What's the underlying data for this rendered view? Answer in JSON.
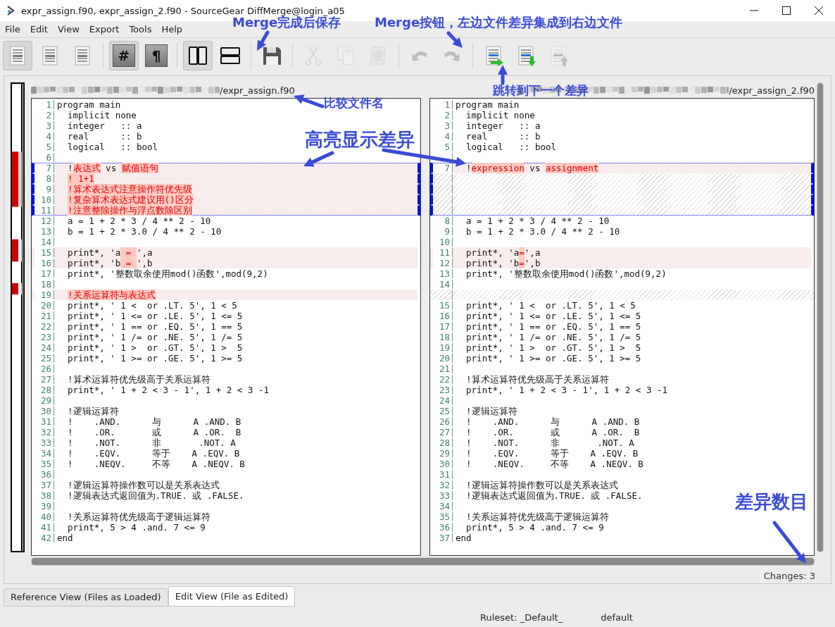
{
  "window": {
    "title": "expr_assign.f90, expr_assign_2.f90 - SourceGear DiffMerge@login_a05"
  },
  "menu": [
    "File",
    "Edit",
    "View",
    "Export",
    "Tools",
    "Help"
  ],
  "toolbar": [
    [
      {
        "pressed": true,
        "disabled": false
      },
      {
        "pressed": false,
        "disabled": false
      },
      {
        "pressed": false,
        "disabled": false
      }
    ],
    [
      {
        "pressed": true,
        "disabled": false,
        "glyph": "#"
      },
      {
        "pressed": false,
        "disabled": false,
        "glyph": "¶"
      }
    ],
    [
      {
        "pressed": true,
        "disabled": false
      },
      {
        "pressed": false,
        "disabled": false
      }
    ],
    [
      {
        "pressed": false,
        "disabled": false
      }
    ],
    [
      {
        "pressed": false,
        "disabled": true
      },
      {
        "pressed": false,
        "disabled": true
      },
      {
        "pressed": false,
        "disabled": true
      }
    ],
    [
      {
        "pressed": false,
        "disabled": true
      },
      {
        "pressed": false,
        "disabled": true
      }
    ],
    [
      {
        "pressed": false,
        "disabled": false
      },
      {
        "pressed": false,
        "disabled": false
      },
      {
        "pressed": false,
        "disabled": true
      }
    ]
  ],
  "left": {
    "file": "/expr_assign.f90",
    "rows": [
      {
        "num": "1",
        "kind": "same",
        "current": false,
        "text": "program main"
      },
      {
        "num": "2",
        "kind": "same",
        "current": false,
        "text": "  implicit none"
      },
      {
        "num": "3",
        "kind": "same",
        "current": false,
        "text": "  integer   :: a"
      },
      {
        "num": "4",
        "kind": "same",
        "current": false,
        "text": "  real      :: b"
      },
      {
        "num": "5",
        "kind": "same",
        "current": false,
        "text": "  logical   :: bool"
      },
      {
        "num": "6",
        "kind": "same",
        "current": false
      },
      {
        "num": "7",
        "kind": "changed",
        "current": true,
        "parts": [
          {
            "text": "  !",
            "diff": false
          },
          {
            "text": "表达式",
            "diff": true
          },
          {
            "text": " vs ",
            "diff": false
          },
          {
            "text": "赋值语句",
            "diff": true
          }
        ]
      },
      {
        "num": "8",
        "kind": "changed",
        "current": true,
        "indented": true,
        "parts": [
          {
            "text": "! 1+1",
            "diff": true
          }
        ]
      },
      {
        "num": "9",
        "kind": "changed",
        "current": true,
        "indented": true,
        "parts": [
          {
            "text": "!算术表达式注意操作符优先级",
            "diff": true
          }
        ]
      },
      {
        "num": "10",
        "kind": "changed",
        "current": true,
        "indented": true,
        "parts": [
          {
            "text": "!复杂算术表达式建议用()区分",
            "diff": true
          }
        ]
      },
      {
        "num": "11",
        "kind": "changed",
        "current": true,
        "indented": true,
        "parts": [
          {
            "text": "!注意整除操作与浮点数除区别",
            "diff": true
          }
        ]
      },
      {
        "num": "12",
        "kind": "same",
        "current": false,
        "text": "  a = 1 + 2 * 3 / 4 ** 2 - 10"
      },
      {
        "num": "13",
        "kind": "same",
        "current": false,
        "text": "  b = 1 + 2 * 3.0 / 4 ** 2 - 10"
      },
      {
        "num": "14",
        "kind": "same",
        "current": false
      },
      {
        "num": "15",
        "kind": "changed",
        "current": false,
        "parts": [
          {
            "text": "  print*, 'a",
            "diff": false
          },
          {
            "text": " = ",
            "diff": true
          },
          {
            "text": "',a",
            "diff": false
          }
        ]
      },
      {
        "num": "16",
        "kind": "changed",
        "current": false,
        "parts": [
          {
            "text": "  print*, 'b",
            "diff": false
          },
          {
            "text": " = ",
            "diff": true
          },
          {
            "text": "',b",
            "diff": false
          }
        ]
      },
      {
        "num": "17",
        "kind": "same",
        "current": false,
        "text": "  print*, '整数取余使用mod()函数',mod(9,2)"
      },
      {
        "num": "18",
        "kind": "same",
        "current": false
      },
      {
        "num": "19",
        "kind": "changed",
        "current": false,
        "indented": true,
        "parts": [
          {
            "text": "!关系运算符与表达式",
            "diff": true
          }
        ]
      },
      {
        "num": "20",
        "kind": "same",
        "current": false,
        "text": "  print*, ' 1 <  or .LT. 5', 1 < 5"
      },
      {
        "num": "21",
        "kind": "same",
        "current": false,
        "text": "  print*, ' 1 <= or .LE. 5', 1 <= 5"
      },
      {
        "num": "22",
        "kind": "same",
        "current": false,
        "text": "  print*, ' 1 == or .EQ. 5', 1 == 5"
      },
      {
        "num": "23",
        "kind": "same",
        "current": false,
        "text": "  print*, ' 1 /= or .NE. 5', 1 /= 5"
      },
      {
        "num": "24",
        "kind": "same",
        "current": false,
        "text": "  print*, ' 1 >  or .GT. 5', 1 >  5"
      },
      {
        "num": "25",
        "kind": "same",
        "current": false,
        "text": "  print*, ' 1 >= or .GE. 5', 1 >= 5"
      },
      {
        "num": "26",
        "kind": "same",
        "current": false
      },
      {
        "num": "27",
        "kind": "same",
        "current": false,
        "text": "  !算术运算符优先级高于关系运算符"
      },
      {
        "num": "28",
        "kind": "same",
        "current": false,
        "text": "  print*, ' 1 + 2 < 3 - 1', 1 + 2 < 3 -1"
      },
      {
        "num": "29",
        "kind": "same",
        "current": false
      },
      {
        "num": "30",
        "kind": "same",
        "current": false,
        "text": "  !逻辑运算符"
      },
      {
        "num": "31",
        "kind": "same",
        "current": false,
        "text": "  !    .AND.      与      A .AND. B"
      },
      {
        "num": "32",
        "kind": "same",
        "current": false,
        "text": "  !    .OR.       或      A .OR.  B"
      },
      {
        "num": "33",
        "kind": "same",
        "current": false,
        "text": "  !    .NOT.      非       .NOT. A"
      },
      {
        "num": "34",
        "kind": "same",
        "current": false,
        "text": "  !    .EQV.      等于    A .EQV. B"
      },
      {
        "num": "35",
        "kind": "same",
        "current": false,
        "text": "  !    .NEQV.     不等    A .NEQV. B"
      },
      {
        "num": "36",
        "kind": "same",
        "current": false
      },
      {
        "num": "37",
        "kind": "same",
        "current": false,
        "text": "  !逻辑运算符操作数可以是关系表达式"
      },
      {
        "num": "38",
        "kind": "same",
        "current": false,
        "text": "  !逻辑表达式返回值为.TRUE. 或 .FALSE."
      },
      {
        "num": "39",
        "kind": "same",
        "current": false
      },
      {
        "num": "40",
        "kind": "same",
        "current": false,
        "text": "  !关系运算符优先级高于逻辑运算符"
      },
      {
        "num": "41",
        "kind": "same",
        "current": false,
        "text": "  print*, 5 > 4 .and. 7 <= 9"
      },
      {
        "num": "42",
        "kind": "same",
        "current": false,
        "text": "end"
      }
    ]
  },
  "right": {
    "file": "/expr_assign_2.f90",
    "rows": [
      {
        "num": "1",
        "kind": "same",
        "current": false,
        "text": "program main"
      },
      {
        "num": "2",
        "kind": "same",
        "current": false,
        "text": "  implicit none"
      },
      {
        "num": "3",
        "kind": "same",
        "current": false,
        "text": "  integer   :: a"
      },
      {
        "num": "4",
        "kind": "same",
        "current": false,
        "text": "  real      :: b"
      },
      {
        "num": "5",
        "kind": "same",
        "current": false,
        "text": "  logical   :: bool"
      },
      {
        "kind": "same",
        "current": false
      },
      {
        "num": "7",
        "kind": "changed",
        "current": true,
        "parts": [
          {
            "text": "  !",
            "diff": false
          },
          {
            "text": "expression",
            "diff": true
          },
          {
            "text": " vs ",
            "diff": false
          },
          {
            "text": "assignment",
            "diff": true
          }
        ]
      },
      {
        "kind": "filler",
        "current": true
      },
      {
        "kind": "filler",
        "current": true
      },
      {
        "kind": "filler",
        "current": true
      },
      {
        "kind": "filler",
        "current": true
      },
      {
        "num": "8",
        "kind": "same",
        "current": false,
        "text": "  a = 1 + 2 * 3 / 4 ** 2 - 10"
      },
      {
        "num": "9",
        "kind": "same",
        "current": false,
        "text": "  b = 1 + 2 * 3.0 / 4 ** 2 - 10"
      },
      {
        "num": "10",
        "kind": "same",
        "current": false
      },
      {
        "num": "11",
        "kind": "changed",
        "current": false,
        "parts": [
          {
            "text": "  print*, 'a",
            "diff": false
          },
          {
            "text": "=",
            "diff": true
          },
          {
            "text": "',a",
            "diff": false
          }
        ]
      },
      {
        "num": "12",
        "kind": "changed",
        "current": false,
        "parts": [
          {
            "text": "  print*, 'b",
            "diff": false
          },
          {
            "text": "=",
            "diff": true
          },
          {
            "text": "',b",
            "diff": false
          }
        ]
      },
      {
        "num": "13",
        "kind": "same",
        "current": false,
        "text": "  print*, '整数取余使用mod()函数',mod(9,2)"
      },
      {
        "num": "14",
        "kind": "same",
        "current": false
      },
      {
        "kind": "filler",
        "current": false
      },
      {
        "num": "15",
        "kind": "same",
        "current": false,
        "text": "  print*, ' 1 <  or .LT. 5', 1 < 5"
      },
      {
        "num": "16",
        "kind": "same",
        "current": false,
        "text": "  print*, ' 1 <= or .LE. 5', 1 <= 5"
      },
      {
        "num": "17",
        "kind": "same",
        "current": false,
        "text": "  print*, ' 1 == or .EQ. 5', 1 == 5"
      },
      {
        "num": "18",
        "kind": "same",
        "current": false,
        "text": "  print*, ' 1 /= or .NE. 5', 1 /= 5"
      },
      {
        "num": "19",
        "kind": "same",
        "current": false,
        "text": "  print*, ' 1 >  or .GT. 5', 1 >  5"
      },
      {
        "num": "20",
        "kind": "same",
        "current": false,
        "text": "  print*, ' 1 >= or .GE. 5', 1 >= 5"
      },
      {
        "num": "21",
        "kind": "same",
        "current": false
      },
      {
        "num": "22",
        "kind": "same",
        "current": false,
        "text": "  !算术运算符优先级高于关系运算符"
      },
      {
        "num": "23",
        "kind": "same",
        "current": false,
        "text": "  print*, ' 1 + 2 < 3 - 1', 1 + 2 < 3 -1"
      },
      {
        "num": "24",
        "kind": "same",
        "current": false
      },
      {
        "num": "25",
        "kind": "same",
        "current": false,
        "text": "  !逻辑运算符"
      },
      {
        "num": "26",
        "kind": "same",
        "current": false,
        "text": "  !    .AND.      与      A .AND. B"
      },
      {
        "num": "27",
        "kind": "same",
        "current": false,
        "text": "  !    .OR.       或      A .OR.  B"
      },
      {
        "num": "28",
        "kind": "same",
        "current": false,
        "text": "  !    .NOT.      非       .NOT. A"
      },
      {
        "num": "29",
        "kind": "same",
        "current": false,
        "text": "  !    .EQV.      等于    A .EQV. B"
      },
      {
        "num": "30",
        "kind": "same",
        "current": false,
        "text": "  !    .NEQV.     不等    A .NEQV. B"
      },
      {
        "num": "31",
        "kind": "same",
        "current": false
      },
      {
        "num": "32",
        "kind": "same",
        "current": false,
        "text": "  !逻辑运算符操作数可以是关系表达式"
      },
      {
        "num": "33",
        "kind": "same",
        "current": false,
        "text": "  !逻辑表达式返回值为.TRUE. 或 .FALSE."
      },
      {
        "num": "34",
        "kind": "same",
        "current": false
      },
      {
        "num": "35",
        "kind": "same",
        "current": false,
        "text": "  !关系运算符优先级高于逻辑运算符"
      },
      {
        "num": "36",
        "kind": "same",
        "current": false,
        "text": "  print*, 5 > 4 .and. 7 <= 9"
      },
      {
        "num": "37",
        "kind": "same",
        "current": false,
        "text": "end"
      }
    ]
  },
  "changes_label": "Changes: 3",
  "tabs": [
    {
      "label": "Reference View (Files as Loaded)",
      "selected": false
    },
    {
      "label": "Edit View (File as Edited)",
      "selected": true
    }
  ],
  "status_bar": {
    "ruleset": "Ruleset: _Default_",
    "mode": "default"
  },
  "annotations": [
    {
      "text": "Merge完成后保存"
    },
    {
      "text": "Merge按钮，左边文件差异集成到右边文件"
    },
    {
      "text": "跳转到下一个差异"
    },
    {
      "text": "比较文件名"
    },
    {
      "text": "高亮显示差异"
    },
    {
      "text": "差异数目"
    }
  ]
}
